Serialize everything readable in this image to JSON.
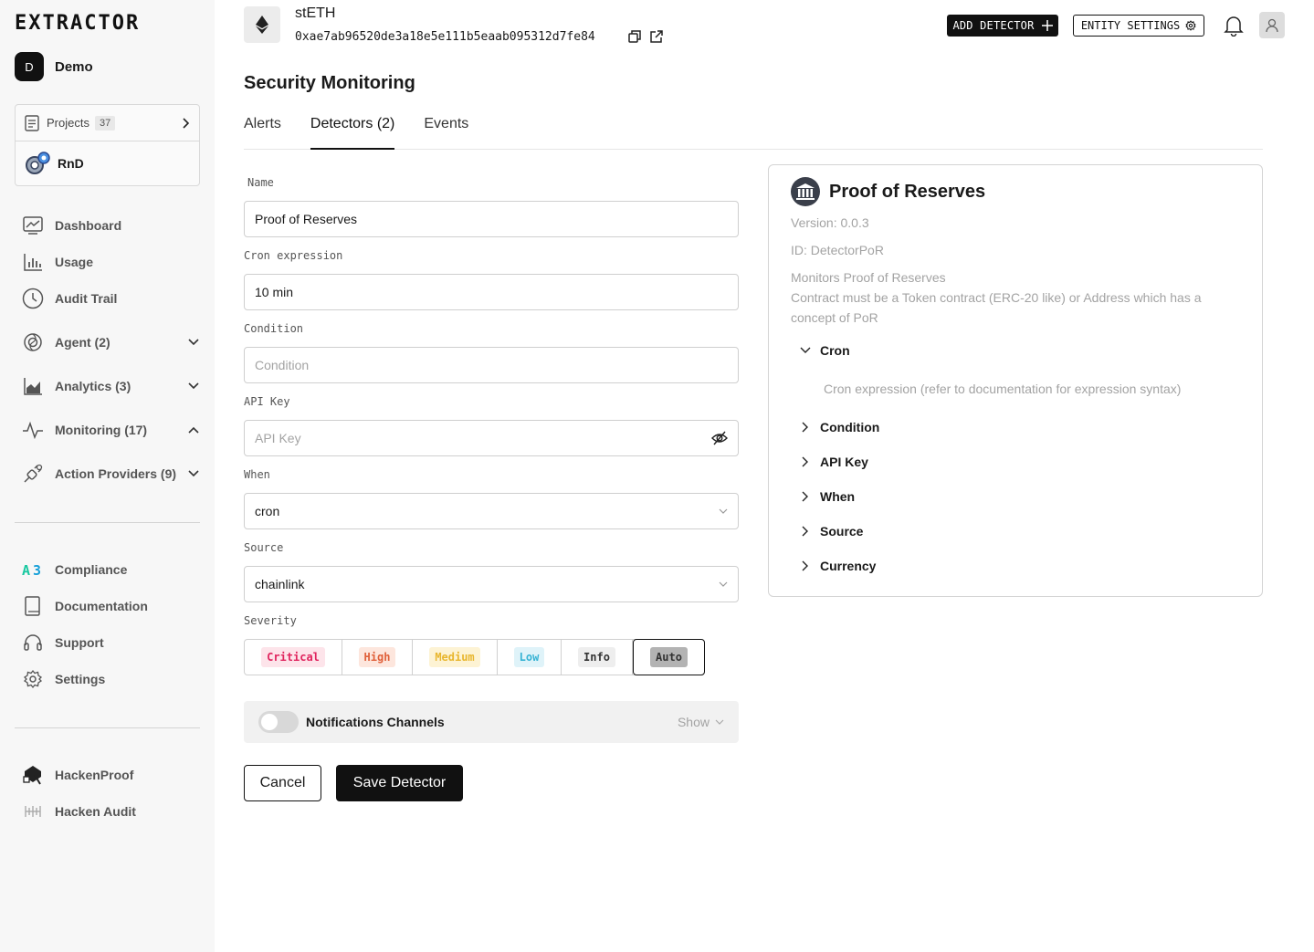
{
  "brand": {
    "logo_text": "EXTRACTOR"
  },
  "org": {
    "initial": "D",
    "name": "Demo"
  },
  "projects": {
    "label": "Projects",
    "count": "37",
    "current": "RnD"
  },
  "nav": [
    {
      "label": "Dashboard",
      "icon": "dashboard-icon"
    },
    {
      "label": "Usage",
      "icon": "bar-chart-icon"
    },
    {
      "label": "Audit Trail",
      "icon": "clock-icon"
    },
    {
      "label": "Agent (2)",
      "icon": "agent-icon"
    },
    {
      "label": "Analytics (3)",
      "icon": "area-chart-icon"
    },
    {
      "label": "Monitoring (17)",
      "icon": "pulse-icon"
    },
    {
      "label": "Action Providers (9)",
      "icon": "plug-icon"
    }
  ],
  "nav_secondary": [
    {
      "label": "Compliance",
      "icon": "compliance-icon"
    },
    {
      "label": "Documentation",
      "icon": "book-icon"
    },
    {
      "label": "Support",
      "icon": "headset-icon"
    },
    {
      "label": "Settings",
      "icon": "gear-icon"
    }
  ],
  "nav_external": [
    {
      "label": "HackenProof",
      "icon": "hackenproof-icon"
    },
    {
      "label": "Hacken Audit",
      "icon": "hacken-audit-icon"
    }
  ],
  "header": {
    "token_name": "stETH",
    "token_address": "0xae7ab96520de3a18e5e111b5eaab095312d7fe84",
    "add_detector": "ADD DETECTOR",
    "entity_settings": "ENTITY SETTINGS"
  },
  "page": {
    "title": "Security Monitoring",
    "tabs": [
      "Alerts",
      "Detectors (2)",
      "Events"
    ],
    "active_tab": "Detectors (2)"
  },
  "form": {
    "name": {
      "label": "Name",
      "value": "Proof of Reserves"
    },
    "cron": {
      "label": "Cron expression",
      "value": "10 min"
    },
    "condition": {
      "label": "Condition",
      "placeholder": "Condition"
    },
    "api_key": {
      "label": "API Key",
      "placeholder": "API Key"
    },
    "when": {
      "label": "When",
      "value": "cron"
    },
    "source": {
      "label": "Source",
      "value": "chainlink"
    },
    "severity": {
      "label": "Severity",
      "options": [
        "Critical",
        "High",
        "Medium",
        "Low",
        "Info",
        "Auto"
      ],
      "selected": "Auto"
    },
    "notifications": {
      "label": "Notifications Channels",
      "show": "Show",
      "enabled": false
    },
    "cancel": "Cancel",
    "save": "Save Detector"
  },
  "panel": {
    "title": "Proof of Reserves",
    "version": "Version: 0.0.3",
    "id": "ID: DetectorPoR",
    "desc_1": "Monitors Proof of Reserves",
    "desc_2": "Contract must be a Token contract (ERC-20 like) or Address which has a concept of PoR",
    "sections": [
      "Cron",
      "Condition",
      "API Key",
      "When",
      "Source",
      "Currency"
    ],
    "cron_help": "Cron expression (refer to documentation for expression syntax)"
  },
  "colors": {
    "critical": "#e0245e",
    "critical_bg": "#fde4ea",
    "high": "#e0603a",
    "high_bg": "#fde6dd",
    "medium": "#e8b62e",
    "medium_bg": "#fdf3d4",
    "low": "#36b3d4",
    "low_bg": "#dff3f9",
    "info": "#333333",
    "info_bg": "#eeeeee",
    "auto": "#333333",
    "auto_bg": "#b3b3b3"
  }
}
